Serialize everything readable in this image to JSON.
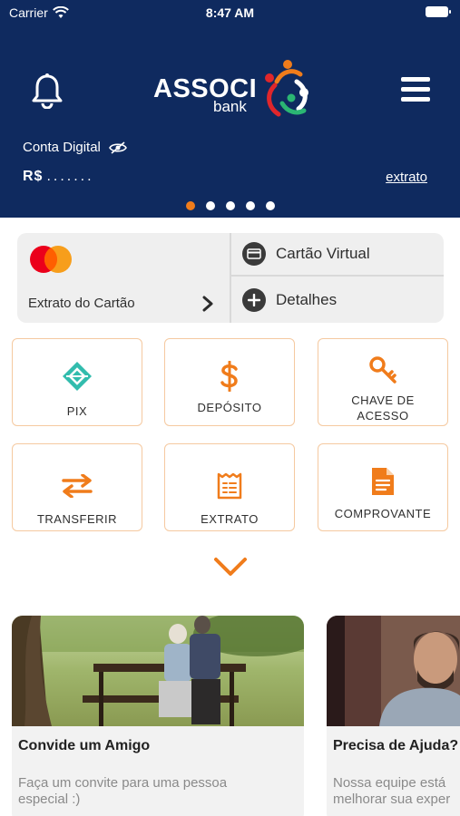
{
  "status_bar": {
    "carrier": "Carrier",
    "time": "8:47 AM"
  },
  "header": {
    "logo_text": "ASSOCI",
    "logo_sub": "bank",
    "account_label": "Conta Digital",
    "balance_currency": "R$",
    "balance_masked": ".......",
    "statement_link": "extrato",
    "carousel_pages": 5,
    "carousel_active": 1
  },
  "card_panel": {
    "statement_label": "Extrato do Cartão",
    "virtual_card_label": "Cartão Virtual",
    "details_label": "Detalhes"
  },
  "actions": [
    {
      "label": "PIX",
      "icon": "pix-icon"
    },
    {
      "label": "DEPÓSITO",
      "icon": "dollar-icon"
    },
    {
      "label_line1": "CHAVE DE",
      "label_line2": "ACESSO",
      "icon": "key-icon"
    },
    {
      "label": "TRANSFERIR",
      "icon": "transfer-arrows-icon"
    },
    {
      "label": "EXTRATO",
      "icon": "receipt-icon"
    },
    {
      "label": "COMPROVANTE",
      "icon": "document-icon"
    }
  ],
  "promos": [
    {
      "title": "Convide um Amigo",
      "desc_line1": "Faça um convite para uma pessoa",
      "desc_line2": "especial :)"
    },
    {
      "title": "Precisa de Ajuda?",
      "desc_line1": "Nossa equipe está",
      "desc_line2": "melhorar sua exper"
    }
  ],
  "colors": {
    "header_bg": "#0f2a5f",
    "accent": "#f07c1b",
    "pix": "#32bcad",
    "tile_border": "#f5c9a0"
  }
}
